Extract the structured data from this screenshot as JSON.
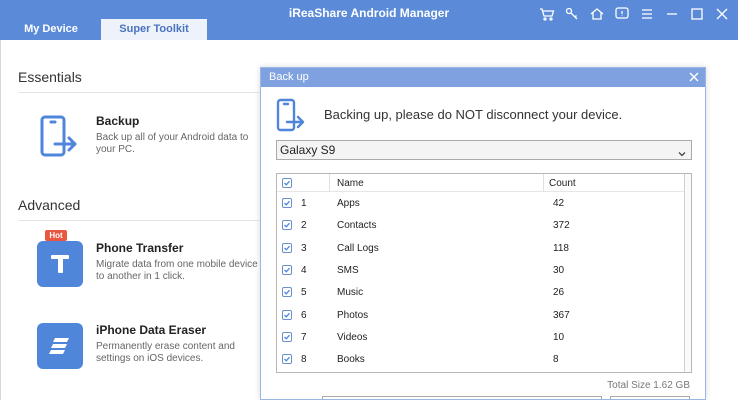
{
  "app": {
    "title": "iReaShare Android Manager",
    "tabs": [
      {
        "label": "My Device",
        "active": false
      },
      {
        "label": "Super Toolkit",
        "active": true
      }
    ],
    "window_icons": [
      "cart-icon",
      "key-icon",
      "home-icon",
      "feedback-icon",
      "menu-icon",
      "minimize-icon",
      "maximize-icon",
      "close-icon"
    ],
    "accent": "#5b8bd8"
  },
  "sections": {
    "essentials": "Essentials",
    "advanced": "Advanced"
  },
  "features": [
    {
      "name": "Backup",
      "desc": "Back up all of your Android data to your PC.",
      "icon": "backup-phone-icon"
    },
    {
      "name": "Phone Transfer",
      "desc": "Migrate data from one mobile device to another in 1 click.",
      "badge": "Hot",
      "icon": "transfer-icon"
    },
    {
      "name": "iPhone Data Eraser",
      "desc": "Permanently erase content and settings on iOS devices.",
      "icon": "eraser-icon"
    }
  ],
  "dialog": {
    "title": "Back up",
    "message": "Backing up, please do NOT disconnect your device.",
    "device": "Galaxy S9",
    "columns": {
      "name": "Name",
      "count": "Count"
    },
    "rows": [
      {
        "idx": "1",
        "name": "Apps",
        "count": "42",
        "checked": true
      },
      {
        "idx": "2",
        "name": "Contacts",
        "count": "372",
        "checked": true
      },
      {
        "idx": "3",
        "name": "Call Logs",
        "count": "118",
        "checked": true
      },
      {
        "idx": "4",
        "name": "SMS",
        "count": "30",
        "checked": true
      },
      {
        "idx": "5",
        "name": "Music",
        "count": "26",
        "checked": true
      },
      {
        "idx": "6",
        "name": "Photos",
        "count": "367",
        "checked": true
      },
      {
        "idx": "7",
        "name": "Videos",
        "count": "10",
        "checked": true
      },
      {
        "idx": "8",
        "name": "Books",
        "count": "8",
        "checked": true
      }
    ],
    "total": "Total Size 1.62 GB"
  }
}
